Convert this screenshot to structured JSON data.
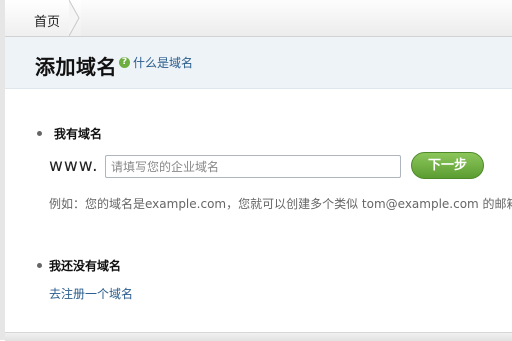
{
  "breadcrumb": {
    "home_label": "首页"
  },
  "header": {
    "title": "添加域名",
    "help_link": "什么是域名"
  },
  "have_domain": {
    "title": "我有域名",
    "prefix": "www.",
    "input_placeholder": "请填写您的企业域名",
    "next_button": "下一步",
    "example_text": "例如：您的域名是example.com，您就可以创建多个类似 tom@example.com 的邮箱。"
  },
  "no_domain": {
    "title": "我还没有域名",
    "register_link": "去注册一个域名"
  },
  "colors": {
    "accent_green": "#5b9d31",
    "link_blue": "#2a5d8c",
    "header_bg": "#eef3f7"
  }
}
